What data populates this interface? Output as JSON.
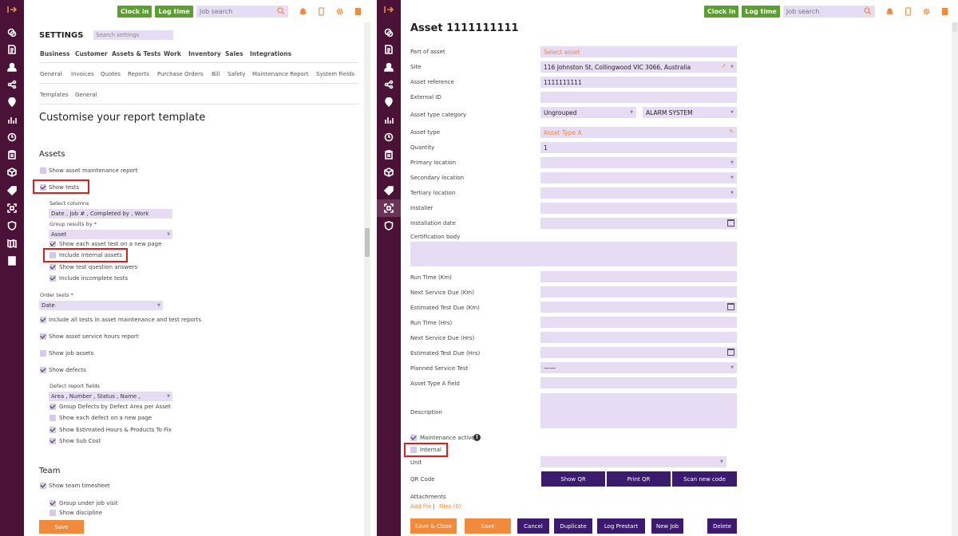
{
  "topbar": {
    "clock_in": "Clock in",
    "log_time": "Log time",
    "job_search_placeholder": "Job search",
    "icons": [
      "search-icon",
      "bell-icon",
      "phone-icon",
      "gear-icon",
      "book-icon"
    ]
  },
  "sidebar": {
    "icons": [
      "exit-icon",
      "coins-icon",
      "document-icon",
      "user-icon",
      "share-icon",
      "location-icon",
      "chart-icon",
      "clock-icon",
      "clipboard-icon",
      "cube-icon",
      "tag-icon",
      "qr-icon",
      "shield-icon",
      "map-icon",
      "book-icon"
    ]
  },
  "left": {
    "settings_title": "SETTINGS",
    "settings_search_placeholder": "Search settings",
    "tabs": [
      "Business",
      "Customer",
      "Assets & Tests",
      "Work",
      "Inventory",
      "Sales",
      "Integrations"
    ],
    "active_tab": "Sales",
    "subtabs": [
      "General",
      "Invoices",
      "Quotes",
      "Reports",
      "Purchase Orders",
      "Bill",
      "Safety",
      "Maintenance Report",
      "System Fields"
    ],
    "active_subtab": "Reports",
    "subsubtabs": [
      "Templates",
      "General"
    ],
    "page_title": "Customise your report template",
    "assets_heading": "Assets",
    "show_asset_maintenance": "Show asset maintenance report",
    "show_tests": "Show tests",
    "select_columns_label": "Select columns",
    "select_columns_value": "Date , Job # , Completed by , Work",
    "group_results_label": "Group results by *",
    "group_results_value": "Asset",
    "show_each_asset_test": "Show each asset test on a new page",
    "include_internal_assets": "Include internal assets",
    "show_test_question_answers": "Show test question answers",
    "include_incomplete_tests": "Include incomplete tests",
    "order_tests_label": "Order tests *",
    "order_tests_value": "Date",
    "include_all_tests": "Include all tests in asset maintenance and test reports",
    "show_asset_service_hours": "Show asset service hours report",
    "show_job_assets": "Show job assets",
    "show_defects": "Show defects",
    "defect_report_fields_label": "Defect report fields",
    "defect_report_fields_value": "Area , Number , Status , Name ,",
    "group_defects": "Group Defects by Defect Area per Asset",
    "show_each_defect": "Show each defect on a new page",
    "show_estimated_hours": "Show Estimated Hours & Products To Fix",
    "show_sub_cost": "Show Sub Cost",
    "team_heading": "Team",
    "show_team_timesheet": "Show team timesheet",
    "group_under_job_visit": "Group under job visit",
    "show_discipline": "Show discipline",
    "save": "Save"
  },
  "right": {
    "title": "Asset 1111111111",
    "fields": {
      "part_of_asset": {
        "label": "Part of asset",
        "placeholder": "Select asset"
      },
      "site": {
        "label": "Site",
        "value": "116 Johnston St, Collingwood VIC 3066, Australia"
      },
      "asset_reference": {
        "label": "Asset reference",
        "value": "1111111111"
      },
      "external_id": {
        "label": "External ID",
        "value": ""
      },
      "asset_type_category": {
        "label": "Asset type category",
        "value": "Ungrouped",
        "value2": "ALARM SYSTEM"
      },
      "asset_type": {
        "label": "Asset type",
        "value": "Asset Type A"
      },
      "quantity": {
        "label": "Quantity",
        "value": "1"
      },
      "primary_location": {
        "label": "Primary location",
        "value": ""
      },
      "secondary_location": {
        "label": "Secondary location",
        "value": ""
      },
      "tertiary_location": {
        "label": "Tertiary location",
        "value": ""
      },
      "installer": {
        "label": "Installer",
        "value": ""
      },
      "installation_date": {
        "label": "Installation date",
        "value": ""
      },
      "certification_body": {
        "label": "Certification body",
        "value": ""
      },
      "run_time_km": {
        "label": "Run Time (Km)",
        "value": ""
      },
      "next_service_due_km": {
        "label": "Next Service Due (Km)",
        "value": ""
      },
      "estimated_test_due_km": {
        "label": "Estimated Test Due (Km)",
        "value": ""
      },
      "run_time_hrs": {
        "label": "Run Time (Hrs)",
        "value": ""
      },
      "next_service_due_hrs": {
        "label": "Next Service Due (Hrs)",
        "value": ""
      },
      "estimated_test_due_hrs": {
        "label": "Estimated Test Due (Hrs)",
        "value": ""
      },
      "planned_service_test": {
        "label": "Planned Service Test",
        "value": "——"
      },
      "asset_type_a_field": {
        "label": "Asset Type A field",
        "value": ""
      },
      "description": {
        "label": "Description",
        "value": ""
      }
    },
    "maintenance_active": "Maintenance active",
    "internal": "Internal",
    "unit_label": "Unit",
    "qr_code_label": "QR Code",
    "show_qr": "Show QR",
    "print_qr": "Print QR",
    "scan_new_code": "Scan new code",
    "attachments_label": "Attachments",
    "add_file": "Add file",
    "files": "Files (0)",
    "buttons": {
      "save_close": "Save & Close",
      "save": "Save",
      "cancel": "Cancel",
      "duplicate": "Duplicate",
      "log_prestart": "Log Prestart",
      "new_job": "New Job",
      "delete": "Delete"
    }
  },
  "colors": {
    "sidebar": "#4a1236",
    "accent": "#f08a3c",
    "field": "#e6dcf3",
    "primary_button": "#3c1a6e",
    "green_button": "#5aa02c",
    "highlight": "#d62020"
  }
}
